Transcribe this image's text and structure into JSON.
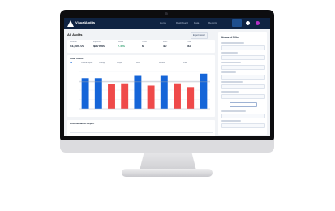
{
  "app": {
    "brand": "VisualAudits",
    "nav": [
      "Home",
      "Dashboard",
      "Data",
      "Reports",
      "Reports"
    ]
  },
  "page": {
    "title": "All Audits",
    "action_label": "Export Excel"
  },
  "kpis": [
    {
      "label": "Revenue",
      "value": "$4,500.00",
      "accent": false
    },
    {
      "label": "Expenses",
      "value": "$879.00",
      "accent": false
    },
    {
      "label": "Growth",
      "value": "7.5%",
      "accent": true
    },
    {
      "label": "Count",
      "value": "6",
      "accent": false
    },
    {
      "label": "Items",
      "value": "40",
      "accent": false
    },
    {
      "label": "Total",
      "value": "52",
      "accent": false
    }
  ],
  "chart_card": {
    "title": "Audit Status",
    "tabs": [
      "Jul",
      "Limited Inquiry",
      "Lineage",
      "Scope",
      "Run",
      "Review",
      "Final"
    ]
  },
  "bottom_card": {
    "title": "Documentation Report"
  },
  "right_panel": {
    "title": "Unsaved Filter"
  },
  "colors": {
    "bar_blue": "#1565d8",
    "bar_red": "#ef4a4a",
    "topbar": "#0f2342",
    "target_line": "#9aa3b1"
  },
  "chart_data": {
    "type": "bar",
    "categories": [
      "",
      "",
      "",
      "",
      "",
      "",
      "",
      "",
      "",
      ""
    ],
    "series": [
      {
        "values": [
          82,
          82,
          66,
          68,
          88,
          62,
          88,
          68,
          58,
          94
        ],
        "colors": [
          "#1565d8",
          "#1565d8",
          "#ef4a4a",
          "#ef4a4a",
          "#1565d8",
          "#ef4a4a",
          "#1565d8",
          "#ef4a4a",
          "#ef4a4a",
          "#1565d8"
        ]
      }
    ],
    "target": 72,
    "ylim": [
      0,
      100
    ],
    "grid": true
  }
}
